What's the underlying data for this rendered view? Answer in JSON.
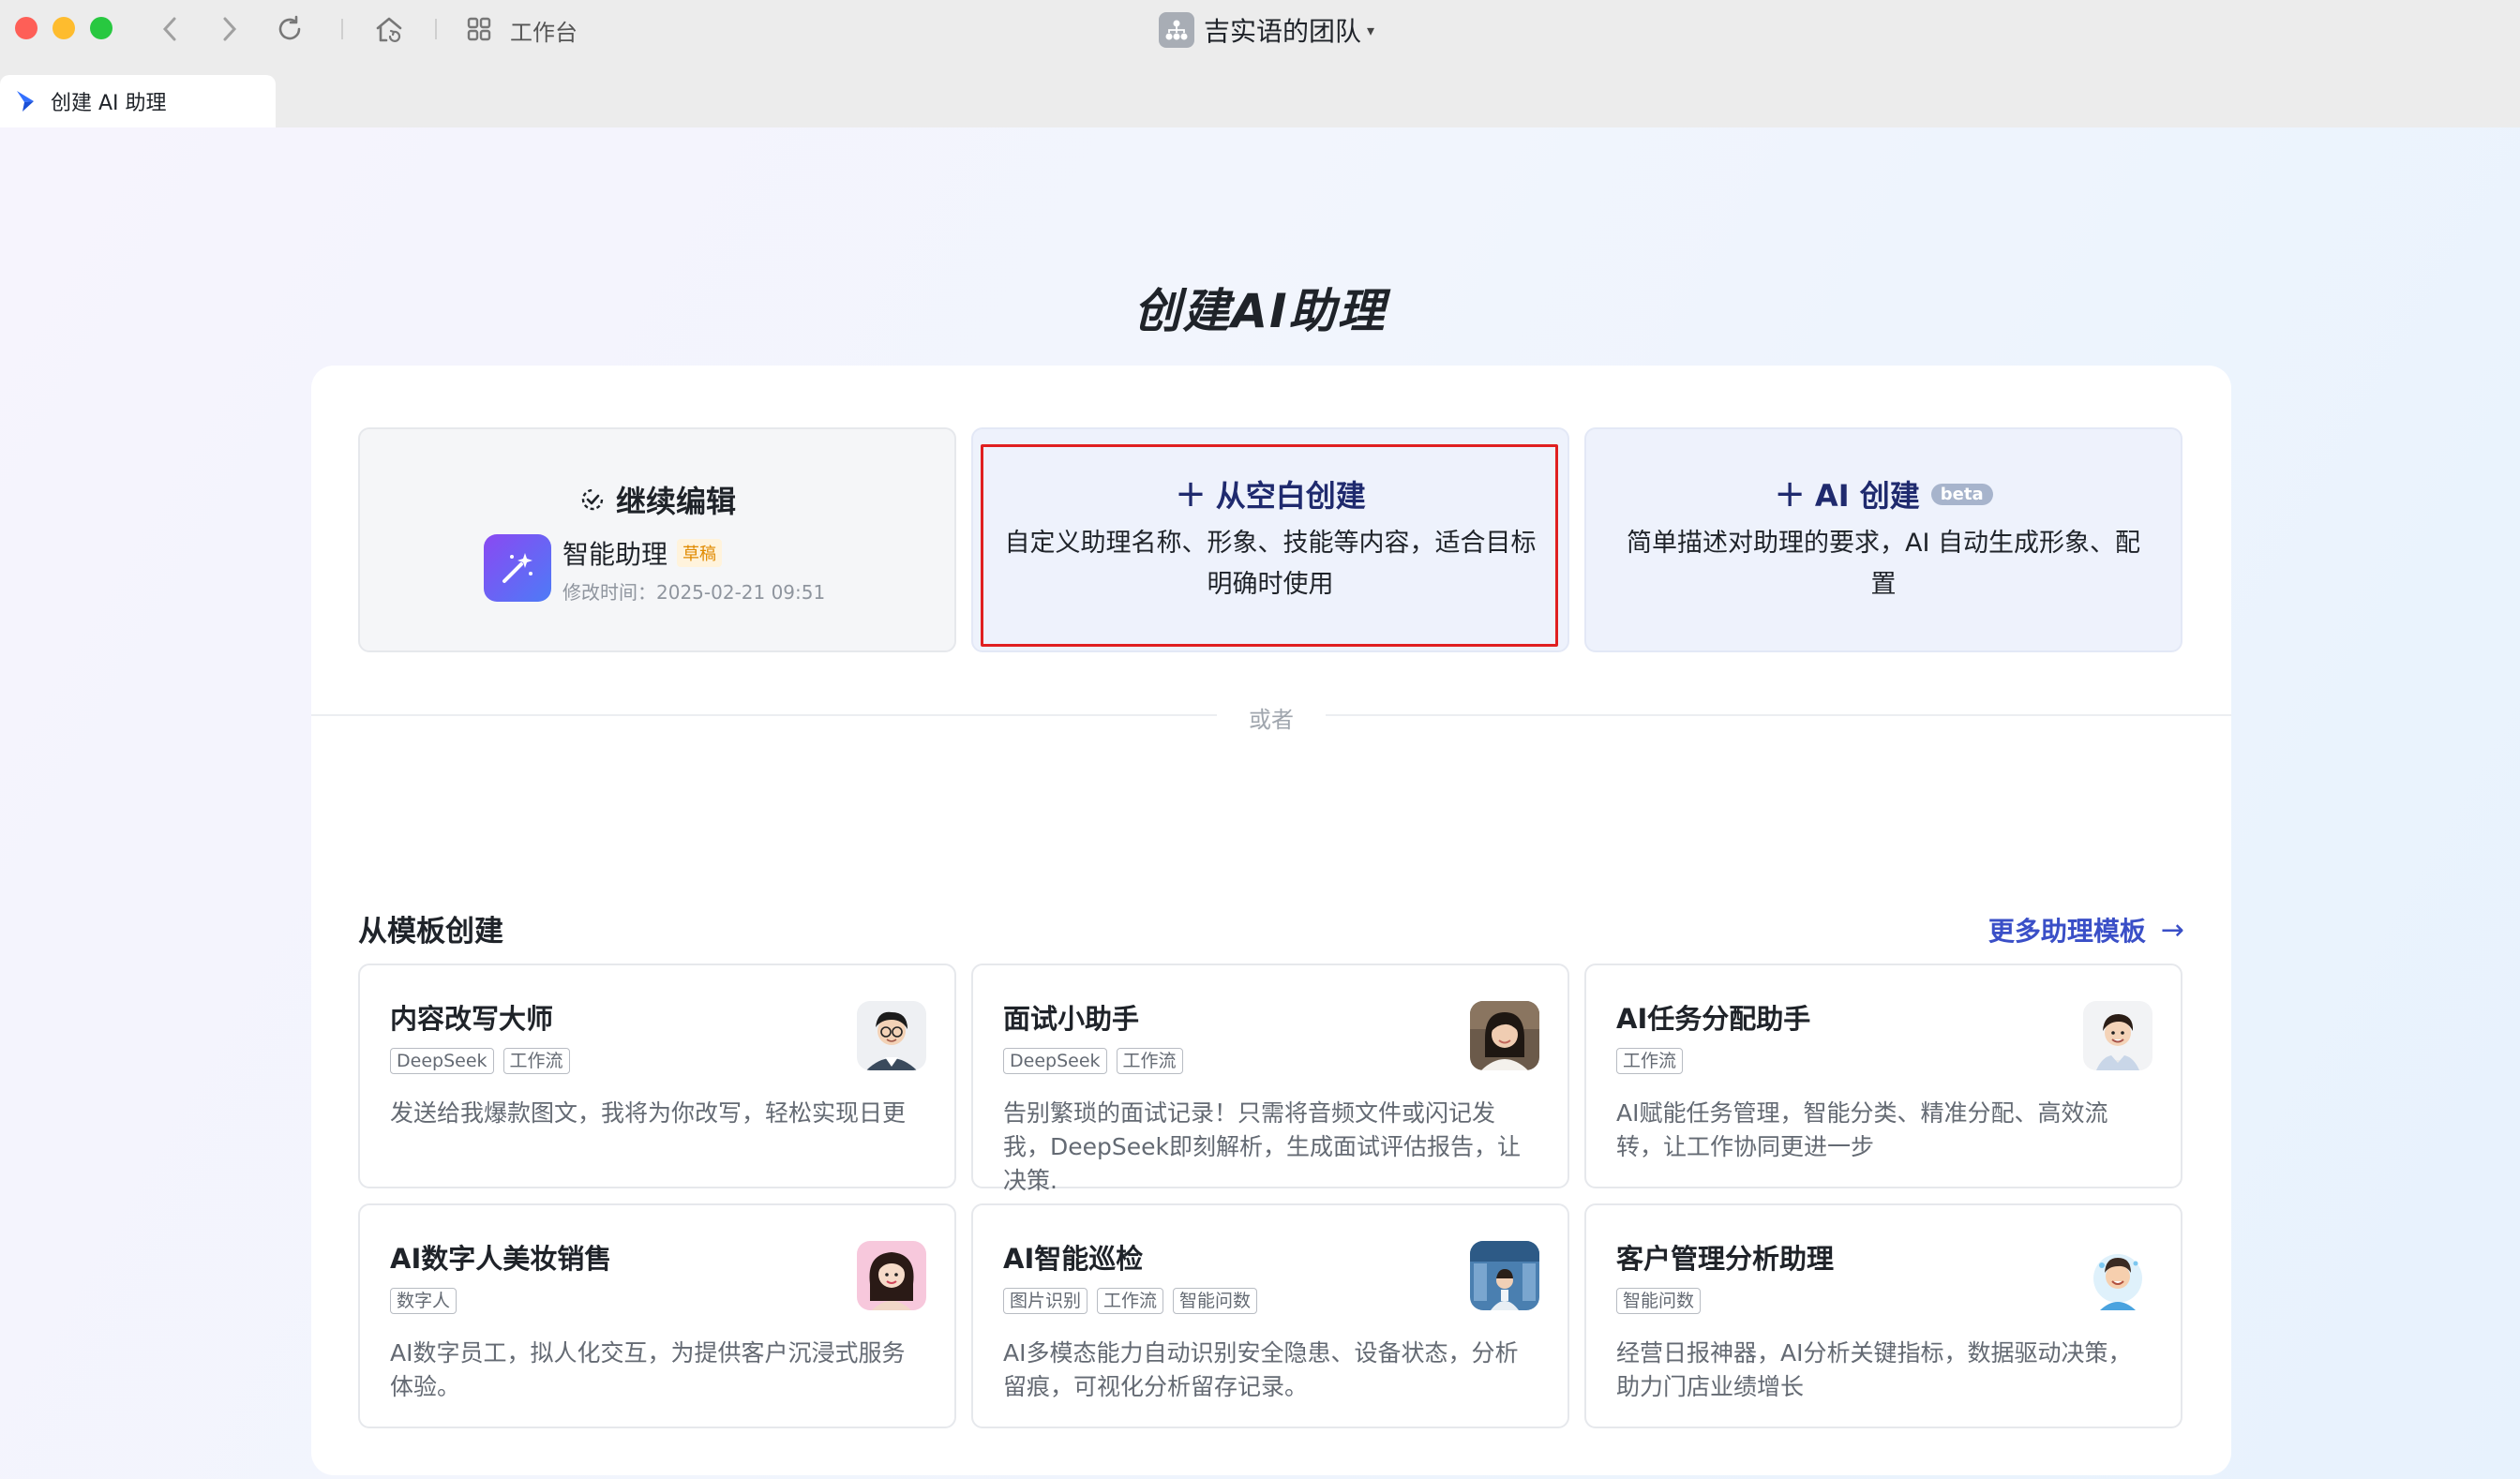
{
  "titlebar": {
    "workbench_label": "工作台",
    "team_name": "吉实语的团队",
    "team_caret": "▾"
  },
  "tab": {
    "label": "创建 AI 助理"
  },
  "page": {
    "title": "创建AI助理"
  },
  "continue_edit": {
    "heading": "继续编辑",
    "assistant_name": "智能助理",
    "draft_badge": "草稿",
    "modified_time": "修改时间：2025-02-21 09:51"
  },
  "blank_create": {
    "plus": "+",
    "heading": "从空白创建",
    "description": "自定义助理名称、形象、技能等内容，适合目标明确时使用"
  },
  "ai_create": {
    "plus": "+",
    "heading": "AI 创建",
    "beta": "beta",
    "description": "简单描述对助理的要求，AI 自动生成形象、配置"
  },
  "divider": {
    "or_label": "或者"
  },
  "templates": {
    "section_title": "从模板创建",
    "more_link": "更多助理模板",
    "more_arrow": "→",
    "items": [
      {
        "name": "内容改写大师",
        "tags": [
          "DeepSeek",
          "工作流"
        ],
        "description": "发送给我爆款图文，我将为你改写，轻松实现日更",
        "avatar_icon": "person-glasses-avatar-icon"
      },
      {
        "name": "面试小助手",
        "tags": [
          "DeepSeek",
          "工作流"
        ],
        "description": "告别繁琐的面试记录！只需将音频文件或闪记发我，DeepSeek即刻解析，生成面试评估报告，让决策.",
        "avatar_icon": "woman-photo-avatar-icon"
      },
      {
        "name": "AI任务分配助手",
        "tags": [
          "工作流"
        ],
        "description": "AI赋能任务管理，智能分类、精准分配、高效流转，让工作协同更进一步",
        "avatar_icon": "young-man-avatar-icon"
      },
      {
        "name": "AI数字人美妆销售",
        "tags": [
          "数字人"
        ],
        "description": "AI数字员工，拟人化交互，为提供客户沉浸式服务体验。",
        "avatar_icon": "woman-pink-avatar-icon"
      },
      {
        "name": "AI智能巡检",
        "tags": [
          "图片识别",
          "工作流",
          "智能问数"
        ],
        "description": "AI多模态能力自动识别安全隐患、设备状态，分析留痕，可视化分析留存记录。",
        "avatar_icon": "warehouse-worker-avatar-icon"
      },
      {
        "name": "客户管理分析助理",
        "tags": [
          "智能问数"
        ],
        "description": "经营日报神器，AI分析关键指标，数据驱动决策，助力门店业绩增长",
        "avatar_icon": "cartoon-man-avatar-icon"
      }
    ]
  },
  "colors": {
    "accent_blue": "#3a4fc7",
    "highlight_red": "#e02020",
    "draft_orange": "#e08a00"
  }
}
